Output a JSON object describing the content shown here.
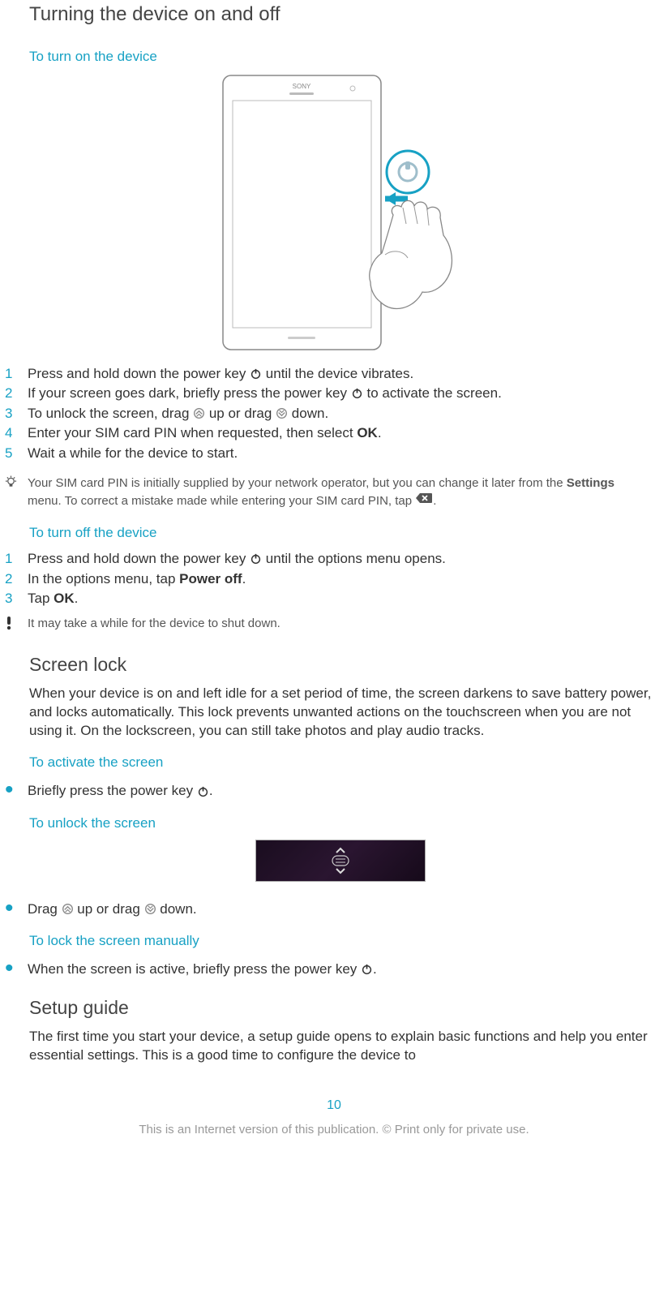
{
  "page_number": "10",
  "footer": "This is an Internet version of this publication. © Print only for private use.",
  "section1": {
    "title": "Turning the device on and off",
    "sub_on": "To turn on the device",
    "steps_on": [
      {
        "n": "1",
        "pre": "Press and hold down the power key ",
        "post": " until the device vibrates."
      },
      {
        "n": "2",
        "pre": "If your screen goes dark, briefly press the power key ",
        "post": " to activate the screen."
      },
      {
        "n": "3",
        "pre": "To unlock the screen, drag ",
        "mid": " up or drag ",
        "post": " down."
      },
      {
        "n": "4",
        "pre": "Enter your SIM card PIN when requested, then select ",
        "bold": "OK",
        "post": "."
      },
      {
        "n": "5",
        "pre": "Wait a while for the device to start."
      }
    ],
    "tip_on_a": "Your SIM card PIN is initially supplied by your network operator, but you can change it later from the ",
    "tip_on_bold": "Settings",
    "tip_on_b": " menu. To correct a mistake made while entering your SIM card PIN, tap ",
    "tip_on_c": ".",
    "sub_off": "To turn off the device",
    "steps_off": [
      {
        "n": "1",
        "pre": "Press and hold down the power key ",
        "post": " until the options menu opens."
      },
      {
        "n": "2",
        "pre": "In the options menu, tap ",
        "bold": "Power off",
        "post": "."
      },
      {
        "n": "3",
        "pre": "Tap ",
        "bold": "OK",
        "post": "."
      }
    ],
    "tip_off": "It may take a while for the device to shut down."
  },
  "section2": {
    "title": "Screen lock",
    "para": "When your device is on and left idle for a set period of time, the screen darkens to save battery power, and locks automatically. This lock prevents unwanted actions on the touchscreen when you are not using it. On the lockscreen, you can still take photos and play audio tracks.",
    "sub_activate": "To activate the screen",
    "bullet_activate_pre": "Briefly press the power key ",
    "bullet_activate_post": ".",
    "sub_unlock": "To unlock the screen",
    "bullet_unlock_pre": "Drag ",
    "bullet_unlock_mid": " up or drag ",
    "bullet_unlock_post": " down.",
    "sub_lock": "To lock the screen manually",
    "bullet_lock_pre": "When the screen is active, briefly press the power key ",
    "bullet_lock_post": "."
  },
  "section3": {
    "title": "Setup guide",
    "para": "The first time you start your device, a setup guide opens to explain basic functions and help you enter essential settings. This is a good time to configure the device to"
  }
}
